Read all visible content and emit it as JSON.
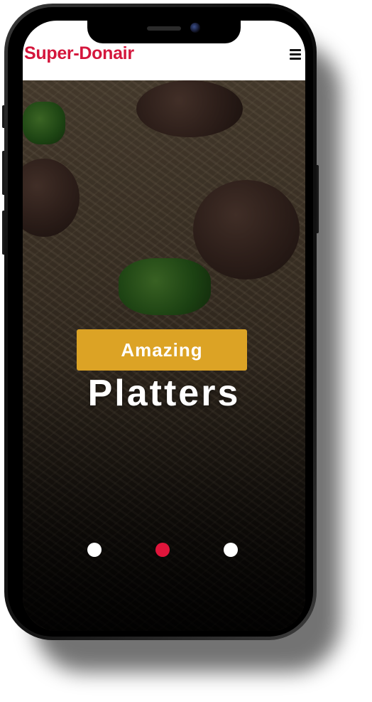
{
  "navbar": {
    "brand": "Super-Donair",
    "menu_icon": "hamburger-menu-icon"
  },
  "hero": {
    "badge": "Amazing",
    "headline": "Platters"
  },
  "carousel": {
    "slide_count": 3,
    "active_index": 1,
    "dots": [
      {
        "color": "#ffffff"
      },
      {
        "color": "#e0153b"
      },
      {
        "color": "#ffffff"
      }
    ]
  },
  "colors": {
    "brand": "#d4163c",
    "badge": "#dca325",
    "active_dot": "#e0153b"
  }
}
